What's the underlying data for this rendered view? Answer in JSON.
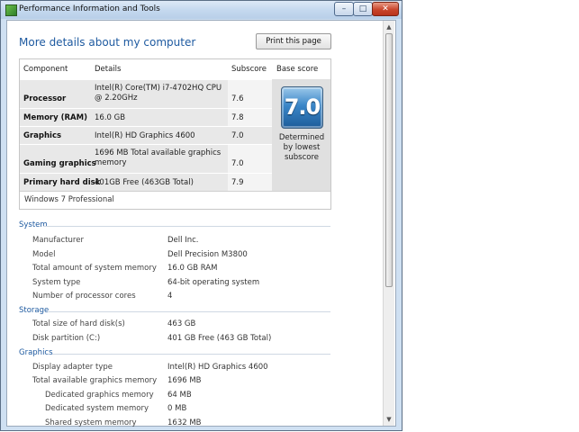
{
  "window": {
    "title": "Performance Information and Tools",
    "minimize_label": "–",
    "maximize_label": "□",
    "close_label": "✕"
  },
  "header": {
    "heading": "More details about my computer",
    "print_button": "Print this page"
  },
  "score_table": {
    "columns": [
      "Component",
      "Details",
      "Subscore",
      "Base score"
    ],
    "rows": [
      {
        "component": "Processor",
        "details": "Intel(R) Core(TM) i7-4702HQ CPU @ 2.20GHz",
        "subscore": "7.6"
      },
      {
        "component": "Memory (RAM)",
        "details": "16.0 GB",
        "subscore": "7.8"
      },
      {
        "component": "Graphics",
        "details": "Intel(R) HD Graphics 4600",
        "subscore": "7.0"
      },
      {
        "component": "Gaming graphics",
        "details": "1696 MB Total available graphics memory",
        "subscore": "7.0"
      },
      {
        "component": "Primary hard disk",
        "details": "401GB Free (463GB Total)",
        "subscore": "7.9"
      }
    ],
    "base_score": "7.0",
    "base_score_note": "Determined by lowest subscore",
    "os": "Windows 7 Professional"
  },
  "sections": [
    {
      "title": "System",
      "items": [
        {
          "label": "Manufacturer",
          "value": "Dell Inc."
        },
        {
          "label": "Model",
          "value": "Dell Precision M3800"
        },
        {
          "label": "Total amount of system memory",
          "value": "16.0 GB RAM"
        },
        {
          "label": "System type",
          "value": "64-bit operating system"
        },
        {
          "label": "Number of processor cores",
          "value": "4"
        }
      ]
    },
    {
      "title": "Storage",
      "items": [
        {
          "label": "Total size of hard disk(s)",
          "value": "463 GB"
        },
        {
          "label": "Disk partition (C:)",
          "value": "401 GB Free (463 GB Total)"
        }
      ]
    },
    {
      "title": "Graphics",
      "items": [
        {
          "label": "Display adapter type",
          "value": "Intel(R) HD Graphics 4600"
        },
        {
          "label": "Total available graphics memory",
          "value": "1696 MB"
        },
        {
          "label": "Dedicated graphics memory",
          "value": "64 MB"
        },
        {
          "label": "Dedicated system memory",
          "value": "0 MB"
        },
        {
          "label": "Shared system memory",
          "value": "1632 MB"
        }
      ]
    }
  ],
  "colors": {
    "heading": "#1e5aa0",
    "badge": "#3a86c8",
    "close_button": "#c9452b"
  }
}
